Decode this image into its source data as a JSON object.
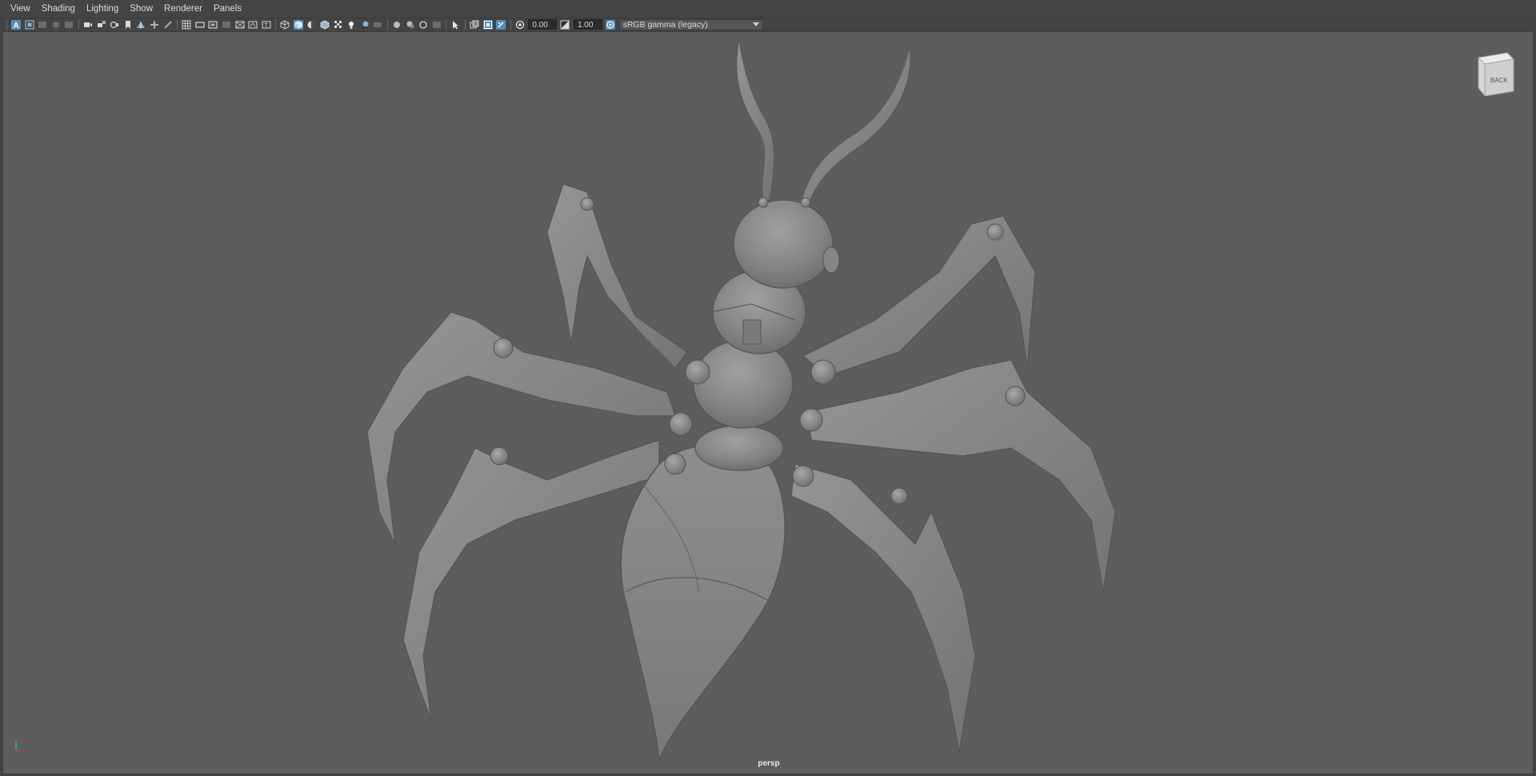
{
  "menu": {
    "items": [
      "View",
      "Shading",
      "Lighting",
      "Show",
      "Renderer",
      "Panels"
    ]
  },
  "toolbar": {
    "exposure_value": "0.00",
    "gamma_value": "1.00",
    "color_space": "sRGB gamma (legacy)",
    "icons": [
      "select-camera-icon",
      "camera-attributes-icon",
      "bookmark-icon",
      "image-plane-icon",
      "2d-pan-zoom-icon",
      "grease-pencil-icon",
      "grid-icon",
      "film-gate-icon",
      "resolution-gate-icon",
      "gate-mask-icon",
      "field-chart-icon",
      "safe-action-icon",
      "safe-title-icon",
      "wireframe-icon",
      "smooth-shade-icon",
      "use-default-material-icon",
      "wireframe-on-shaded-icon",
      "textured-icon",
      "use-all-lights-icon",
      "shadows-icon",
      "screen-space-ao-icon",
      "motion-blur-icon",
      "anti-aliasing-icon",
      "depth-of-field-icon",
      "isolate-select-icon",
      "xray-icon",
      "xray-joints-icon",
      "xray-active-components-icon",
      "exposure-icon",
      "gamma-icon",
      "view-transform-icon"
    ]
  },
  "viewport": {
    "camera_label": "persp",
    "viewcube_face": "BACK",
    "background_color": "#5d5d5d",
    "model_color": "#8a8a8a",
    "accent_color": "#5b8db4"
  }
}
